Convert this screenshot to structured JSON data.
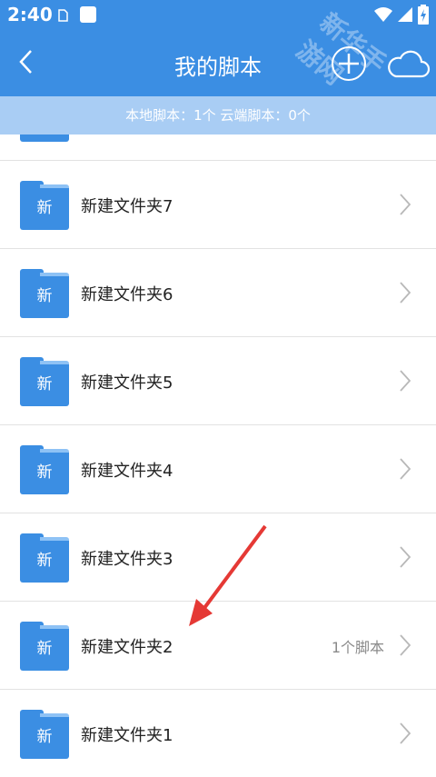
{
  "status_bar": {
    "time": "2:40"
  },
  "header": {
    "title": "我的脚本",
    "back_icon": "chevron-left-icon",
    "add_icon": "plus-circle-icon",
    "cloud_icon": "cloud-icon"
  },
  "summary": {
    "text": "本地脚本：1个 云端脚本：0个"
  },
  "folder_icon_label": "新",
  "folders": [
    {
      "name": "新建文件夹7",
      "count": ""
    },
    {
      "name": "新建文件夹6",
      "count": ""
    },
    {
      "name": "新建文件夹5",
      "count": ""
    },
    {
      "name": "新建文件夹4",
      "count": ""
    },
    {
      "name": "新建文件夹3",
      "count": ""
    },
    {
      "name": "新建文件夹2",
      "count": "1个脚本"
    },
    {
      "name": "新建文件夹1",
      "count": ""
    }
  ],
  "watermark": "新华手游网",
  "colors": {
    "primary": "#3b8ee3",
    "summary_bar": "#a9cdf4",
    "annotation_arrow": "#e53935"
  }
}
